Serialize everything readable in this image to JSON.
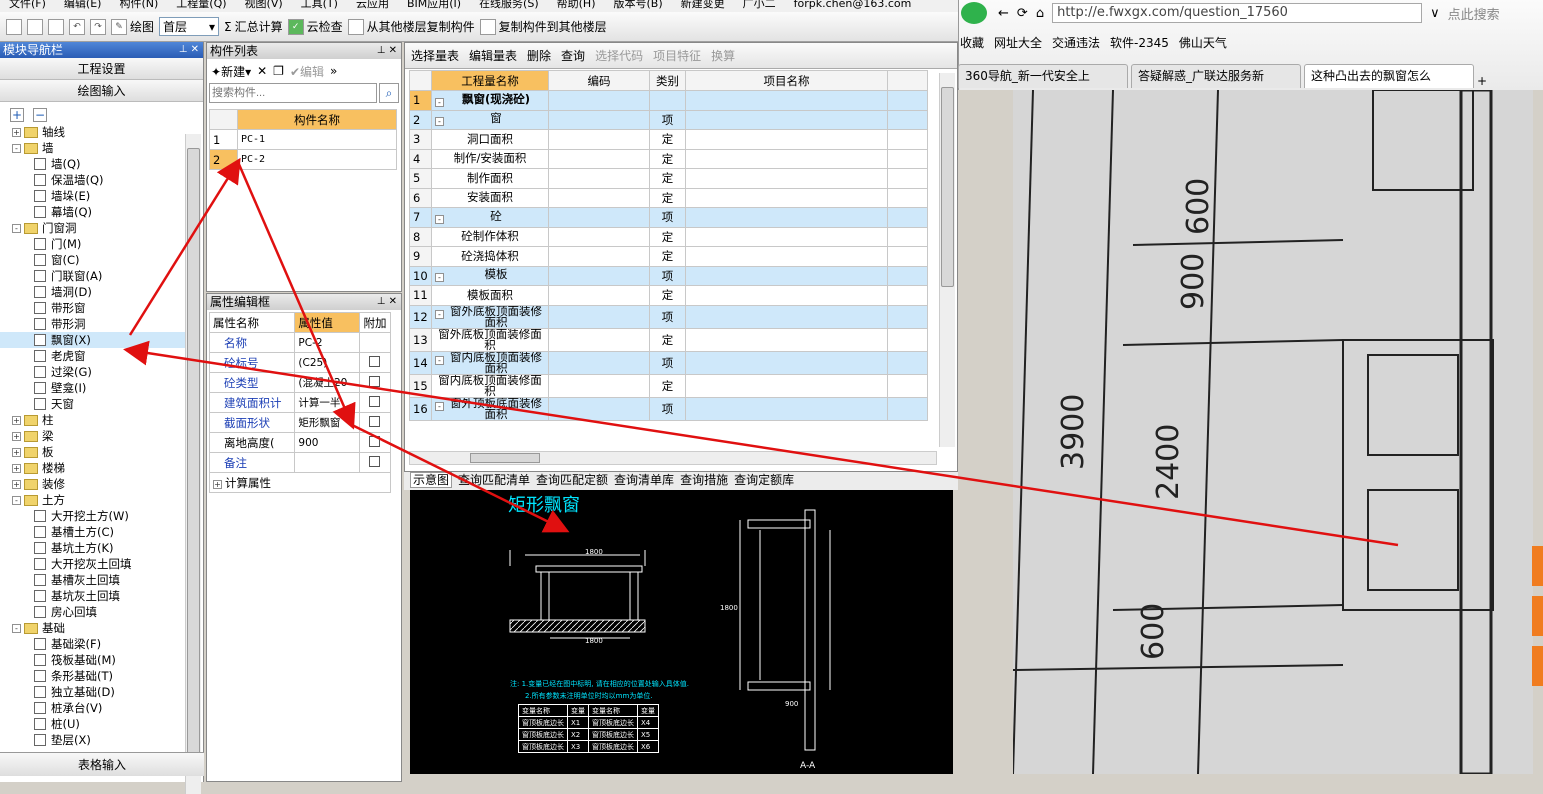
{
  "menu": [
    "文件(F)",
    "编辑(E)",
    "构件(N)",
    "工程量(Q)",
    "视图(V)",
    "工具(T)",
    "云应用",
    "BIM应用(I)",
    "在线服务(S)",
    "帮助(H)",
    "版本号(B)",
    "新建变更",
    "广小二",
    "forpk.chen@163.com"
  ],
  "toolbar": {
    "draw_label": "绘图",
    "floor_value": "首层",
    "sum_label": "汇总计算",
    "cloud_check_label": "云检查",
    "copy_from_label": "从其他楼层复制构件",
    "copy_to_label": "复制构件到其他楼层"
  },
  "nav": {
    "title": "模块导航栏",
    "btn_project": "工程设置",
    "btn_draw": "绘图输入",
    "btn_table": "表格输入",
    "tree": [
      {
        "level": 0,
        "pm": "+",
        "folder": true,
        "label": "轴线"
      },
      {
        "level": 0,
        "pm": "-",
        "folder": true,
        "label": "墙"
      },
      {
        "level": 1,
        "label": "墙(Q)"
      },
      {
        "level": 1,
        "label": "保温墙(Q)"
      },
      {
        "level": 1,
        "label": "墙垛(E)"
      },
      {
        "level": 1,
        "label": "幕墙(Q)"
      },
      {
        "level": 0,
        "pm": "-",
        "folder": true,
        "label": "门窗洞"
      },
      {
        "level": 1,
        "label": "门(M)"
      },
      {
        "level": 1,
        "label": "窗(C)"
      },
      {
        "level": 1,
        "label": "门联窗(A)"
      },
      {
        "level": 1,
        "label": "墙洞(D)"
      },
      {
        "level": 1,
        "label": "带形窗"
      },
      {
        "level": 1,
        "label": "带形洞"
      },
      {
        "level": 1,
        "label": "飘窗(X)",
        "selected": true
      },
      {
        "level": 1,
        "label": "老虎窗"
      },
      {
        "level": 1,
        "label": "过梁(G)"
      },
      {
        "level": 1,
        "label": "壁龛(I)"
      },
      {
        "level": 1,
        "label": "天窗"
      },
      {
        "level": 0,
        "pm": "+",
        "folder": true,
        "label": "柱"
      },
      {
        "level": 0,
        "pm": "+",
        "folder": true,
        "label": "梁"
      },
      {
        "level": 0,
        "pm": "+",
        "folder": true,
        "label": "板"
      },
      {
        "level": 0,
        "pm": "+",
        "folder": true,
        "label": "楼梯"
      },
      {
        "level": 0,
        "pm": "+",
        "folder": true,
        "label": "装修"
      },
      {
        "level": 0,
        "pm": "-",
        "folder": true,
        "label": "土方"
      },
      {
        "level": 1,
        "label": "大开挖土方(W)"
      },
      {
        "level": 1,
        "label": "基槽土方(C)"
      },
      {
        "level": 1,
        "label": "基坑土方(K)"
      },
      {
        "level": 1,
        "label": "大开挖灰土回填"
      },
      {
        "level": 1,
        "label": "基槽灰土回填"
      },
      {
        "level": 1,
        "label": "基坑灰土回填"
      },
      {
        "level": 1,
        "label": "房心回填"
      },
      {
        "level": 0,
        "pm": "-",
        "folder": true,
        "label": "基础"
      },
      {
        "level": 1,
        "label": "基础梁(F)"
      },
      {
        "level": 1,
        "label": "筏板基础(M)"
      },
      {
        "level": 1,
        "label": "条形基础(T)"
      },
      {
        "level": 1,
        "label": "独立基础(D)"
      },
      {
        "level": 1,
        "label": "桩承台(V)"
      },
      {
        "level": 1,
        "label": "桩(U)"
      },
      {
        "level": 1,
        "label": "垫层(X)"
      }
    ]
  },
  "complist": {
    "title": "构件列表",
    "new_label": "新建",
    "edit_label": "编辑",
    "search_placeholder": "搜索构件...",
    "header": "构件名称",
    "rows": [
      {
        "n": "1",
        "name": "PC-1"
      },
      {
        "n": "2",
        "name": "PC-2"
      }
    ]
  },
  "props": {
    "title": "属性编辑框",
    "headers": [
      "属性名称",
      "属性值",
      "附加"
    ],
    "rows": [
      {
        "name": "名称",
        "value": "PC-2",
        "blue": true,
        "check": false
      },
      {
        "name": "砼标号",
        "value": "(C25)",
        "blue": true,
        "check": true
      },
      {
        "name": "砼类型",
        "value": "(混凝土20",
        "blue": true,
        "check": true
      },
      {
        "name": "建筑面积计",
        "value": "计算一半",
        "blue": true,
        "check": true
      },
      {
        "name": "截面形状",
        "value": "矩形飘窗",
        "blue": true,
        "check": true
      },
      {
        "name": "离地高度(",
        "value": "900",
        "blue": false,
        "check": true
      },
      {
        "name": "备注",
        "value": "",
        "blue": true,
        "check": true
      }
    ],
    "calc_label": "计算属性"
  },
  "main_toolbar": [
    "选择量表",
    "编辑量表",
    "删除",
    "查询",
    "选择代码",
    "项目特征",
    "换算"
  ],
  "qty": {
    "headers": [
      "工程量名称",
      "编码",
      "类别",
      "项目名称"
    ],
    "rows": [
      {
        "n": "1",
        "name": "飘窗(现浇砼)",
        "type": "",
        "head": true,
        "pm": "-"
      },
      {
        "n": "2",
        "name": "窗",
        "type": "项",
        "group": true,
        "pm": "-"
      },
      {
        "n": "3",
        "name": "洞口面积",
        "type": "定"
      },
      {
        "n": "4",
        "name": "制作/安装面积",
        "type": "定"
      },
      {
        "n": "5",
        "name": "制作面积",
        "type": "定"
      },
      {
        "n": "6",
        "name": "安装面积",
        "type": "定"
      },
      {
        "n": "7",
        "name": "砼",
        "type": "项",
        "group": true,
        "pm": "-"
      },
      {
        "n": "8",
        "name": "砼制作体积",
        "type": "定"
      },
      {
        "n": "9",
        "name": "砼浇捣体积",
        "type": "定"
      },
      {
        "n": "10",
        "name": "模板",
        "type": "项",
        "group": true,
        "pm": "-"
      },
      {
        "n": "11",
        "name": "模板面积",
        "type": "定"
      },
      {
        "n": "12",
        "name": "窗外底板顶面装修面积",
        "type": "项",
        "group": true,
        "pm": "-"
      },
      {
        "n": "13",
        "name": "窗外底板顶面装修面积",
        "type": "定"
      },
      {
        "n": "14",
        "name": "窗内底板顶面装修面积",
        "type": "项",
        "group": true,
        "pm": "-"
      },
      {
        "n": "15",
        "name": "窗内底板顶面装修面积",
        "type": "定"
      },
      {
        "n": "16",
        "name": "窗外顶板底面装修面积",
        "type": "项",
        "group": true,
        "pm": "-"
      }
    ]
  },
  "bottom_tabs": [
    "示意图",
    "查询匹配清单",
    "查询匹配定额",
    "查询清单库",
    "查询措施",
    "查询定额库"
  ],
  "diagram": {
    "title": "矩形飘窗",
    "note1": "注: 1.变量已经在图中标明, 请在相应的位置处输入具体值.",
    "note2": "2.所有参数未注明单位时均以mm为单位.",
    "table_headers": [
      "变量名称",
      "变量",
      "变量名称",
      "变量"
    ],
    "table_rows": [
      [
        "窗顶板底边长",
        "X1",
        "窗顶板底边长",
        "X4"
      ],
      [
        "窗顶板底边长",
        "X2",
        "窗顶板底边长",
        "X5"
      ],
      [
        "窗顶板底边长",
        "X3",
        "窗顶板底边长",
        "X6"
      ]
    ],
    "section_label": "A-A",
    "dim_1800": "1800",
    "dim_900": "900"
  },
  "browser": {
    "url": "http://e.fwxgx.com/question_17560",
    "search_placeholder": "点此搜索",
    "favs": [
      "收藏",
      "网址大全",
      "交通违法",
      "软件-2345",
      "佛山天气"
    ],
    "tabs": [
      "360导航_新一代安全上",
      "答疑解惑_广联达服务新",
      "这种凸出去的飘窗怎么"
    ]
  },
  "photo_dims": [
    "600",
    "900",
    "3900",
    "2400",
    "600"
  ]
}
